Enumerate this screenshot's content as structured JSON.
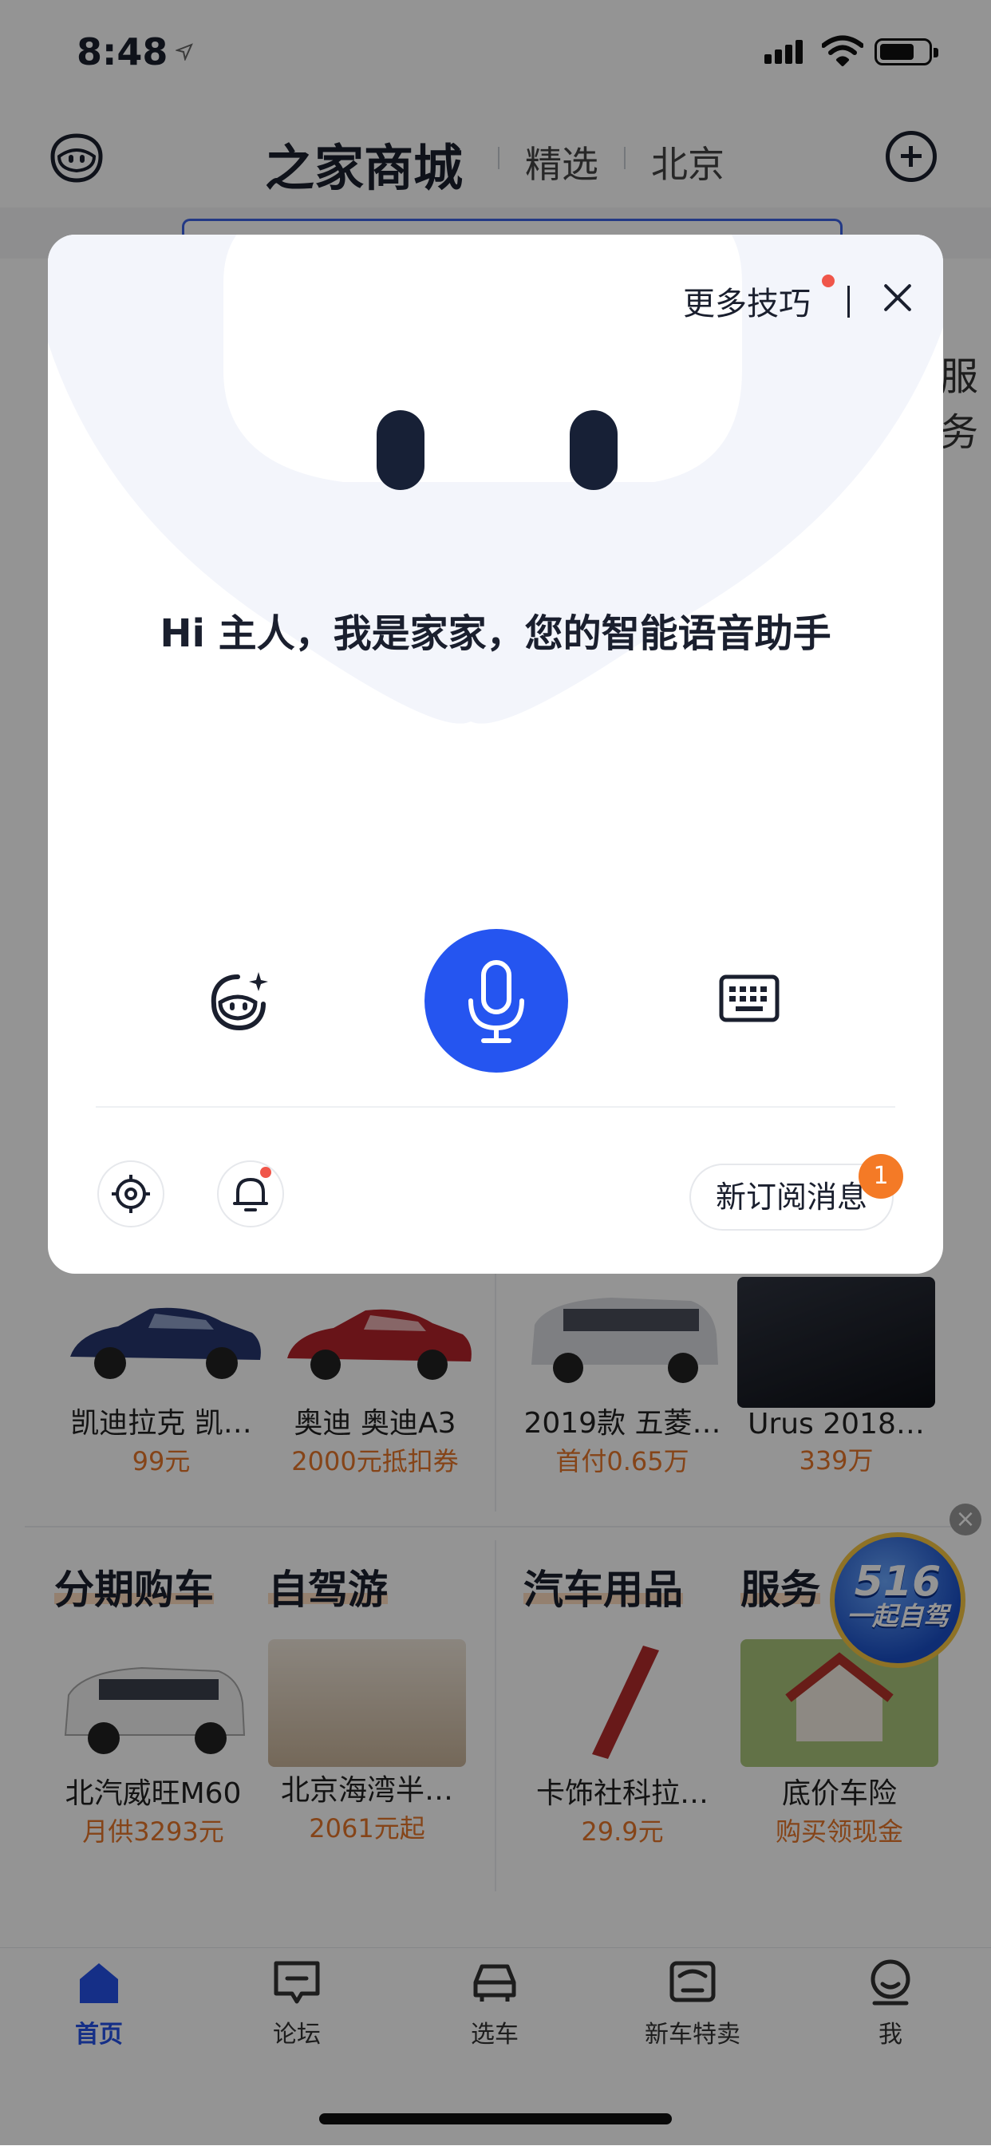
{
  "status_bar": {
    "time": "8:48"
  },
  "header": {
    "title": "之家商城",
    "tabs": [
      {
        "label": "精选"
      },
      {
        "label": "北京"
      }
    ]
  },
  "background": {
    "side_text": "服务",
    "cards_row1": [
      {
        "name": "凯迪拉克 凯…",
        "price": "99元"
      },
      {
        "name": "奥迪 奥迪A3",
        "price": "2000元抵扣券"
      },
      {
        "name": "2019款 五菱…",
        "price": "首付0.65万"
      },
      {
        "name": "Urus 2018…",
        "price": "339万"
      }
    ],
    "categories": [
      {
        "label": "分期购车"
      },
      {
        "label": "自驾游"
      },
      {
        "label": "汽车用品"
      },
      {
        "label": "服务"
      }
    ],
    "cards_row2": [
      {
        "name": "北汽威旺M60",
        "price": "月供3293元"
      },
      {
        "name": "北京海湾半…",
        "price": "2061元起"
      },
      {
        "name": "卡饰社科拉…",
        "price": "29.9元"
      },
      {
        "name": "底价车险",
        "price": "购买领现金"
      }
    ],
    "float_badge": {
      "number": "516",
      "text": "一起自驾"
    }
  },
  "tab_bar": {
    "items": [
      {
        "label": "首页",
        "icon": "home-icon",
        "active": true
      },
      {
        "label": "论坛",
        "icon": "forum-icon",
        "active": false
      },
      {
        "label": "选车",
        "icon": "car-select-icon",
        "active": false
      },
      {
        "label": "新车特卖",
        "icon": "new-car-sale-icon",
        "active": false
      },
      {
        "label": "我",
        "icon": "me-icon",
        "active": false
      }
    ]
  },
  "voice_modal": {
    "tips_label": "更多技巧",
    "greeting": "Hi 主人，我是家家，您的智能语音助手",
    "subscribe_label": "新订阅消息",
    "subscribe_count": "1"
  },
  "colors": {
    "accent": "#2555f0",
    "price": "#e6762a",
    "badge": "#f47a26",
    "alert_dot": "#f0564a"
  }
}
